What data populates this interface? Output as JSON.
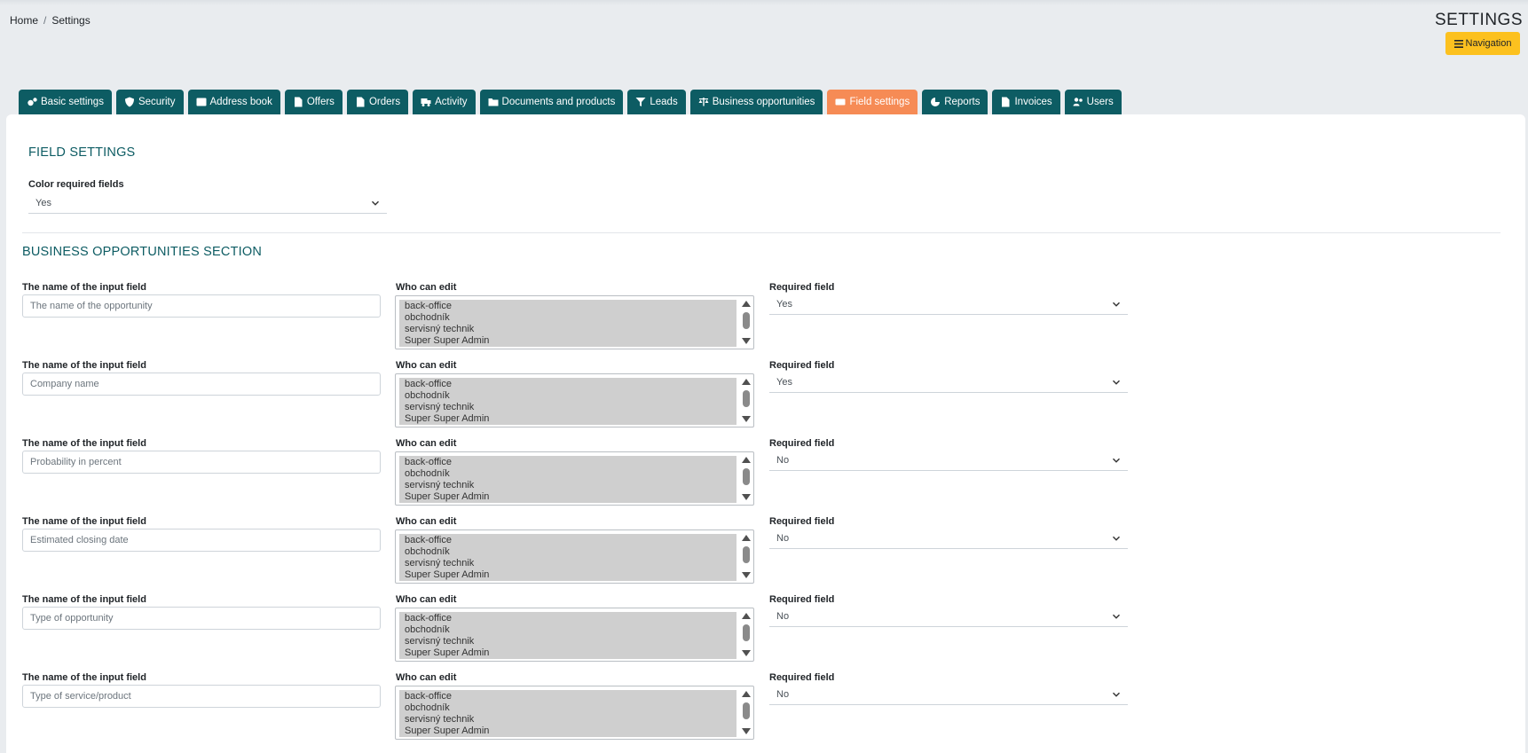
{
  "breadcrumb": {
    "home": "Home",
    "separator": "/",
    "current": "Settings"
  },
  "header": {
    "title": "SETTINGS",
    "nav_button": "Navigation"
  },
  "tabs": [
    {
      "label": "Basic settings",
      "icon": "gears-icon"
    },
    {
      "label": "Security",
      "icon": "shield-icon"
    },
    {
      "label": "Address book",
      "icon": "address-card-icon"
    },
    {
      "label": "Offers",
      "icon": "file-icon"
    },
    {
      "label": "Orders",
      "icon": "file-icon"
    },
    {
      "label": "Activity",
      "icon": "truck-icon"
    },
    {
      "label": "Documents and products",
      "icon": "folder-open-icon"
    },
    {
      "label": "Leads",
      "icon": "funnel-icon"
    },
    {
      "label": "Business opportunities",
      "icon": "scale-icon"
    },
    {
      "label": "Field settings",
      "icon": "keyboard-icon",
      "active": true
    },
    {
      "label": "Reports",
      "icon": "pie-chart-icon"
    },
    {
      "label": "Invoices",
      "icon": "file-icon"
    },
    {
      "label": "Users",
      "icon": "users-icon"
    }
  ],
  "field_settings": {
    "title": "FIELD SETTINGS",
    "color_required_label": "Color required fields",
    "color_required_value": "Yes"
  },
  "business_section": {
    "title": "BUSINESS OPPORTUNITIES SECTION",
    "name_label": "The name of the input field",
    "who_label": "Who can edit",
    "required_label": "Required field",
    "roles": [
      "back-office",
      "obchodník",
      "servisný technik",
      "Super Super Admin"
    ],
    "rows": [
      {
        "placeholder": "The name of the opportunity",
        "required": "Yes"
      },
      {
        "placeholder": "Company name",
        "required": "Yes"
      },
      {
        "placeholder": "Probability in percent",
        "required": "No"
      },
      {
        "placeholder": "Estimated closing date",
        "required": "No"
      },
      {
        "placeholder": "Type of opportunity",
        "required": "No"
      },
      {
        "placeholder": "Type of service/product",
        "required": "No"
      }
    ]
  }
}
